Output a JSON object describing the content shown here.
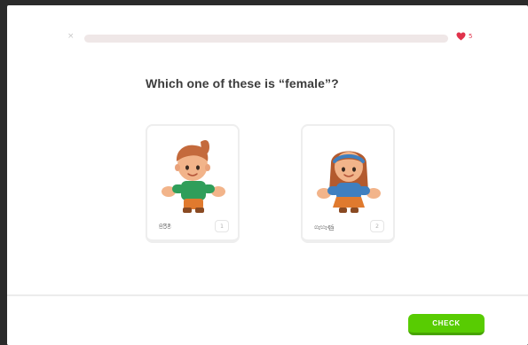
{
  "header": {
    "close_icon": "×",
    "progress_percent": 0,
    "hearts_count": "5",
    "heart_color": "#e0324b"
  },
  "question": {
    "text": "Which one of these is “female”?"
  },
  "choices": [
    {
      "label": "පිරිමි",
      "key": "1",
      "character": "boy-icon"
    },
    {
      "label": "ගැහැණු",
      "key": "2",
      "character": "girl-icon"
    }
  ],
  "footer": {
    "check_label": "CHECK",
    "accent_color": "#58cc02"
  }
}
